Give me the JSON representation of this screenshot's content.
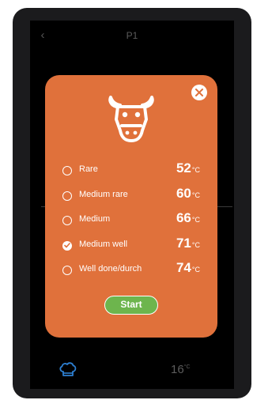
{
  "header": {
    "title": "P1"
  },
  "dialog": {
    "options": [
      {
        "label": "Rare",
        "temp": "52",
        "unit": "°C",
        "selected": false
      },
      {
        "label": "Medium rare",
        "temp": "60",
        "unit": "°C",
        "selected": false
      },
      {
        "label": "Medium",
        "temp": "66",
        "unit": "°C",
        "selected": false
      },
      {
        "label": "Medium well",
        "temp": "71",
        "unit": "°C",
        "selected": true
      },
      {
        "label": "Well done/durch",
        "temp": "74",
        "unit": "°C",
        "selected": false
      }
    ],
    "start_label": "Start"
  },
  "bottom": {
    "temp": "16",
    "unit": "°C"
  },
  "colors": {
    "dialog_bg": "#e0713b",
    "accent_green": "#6db54d",
    "icon_blue": "#2d7fd1"
  },
  "icons": {
    "back": "chevron-left-icon",
    "close": "close-icon",
    "cow": "cow-icon",
    "chef": "chef-hat-icon"
  }
}
